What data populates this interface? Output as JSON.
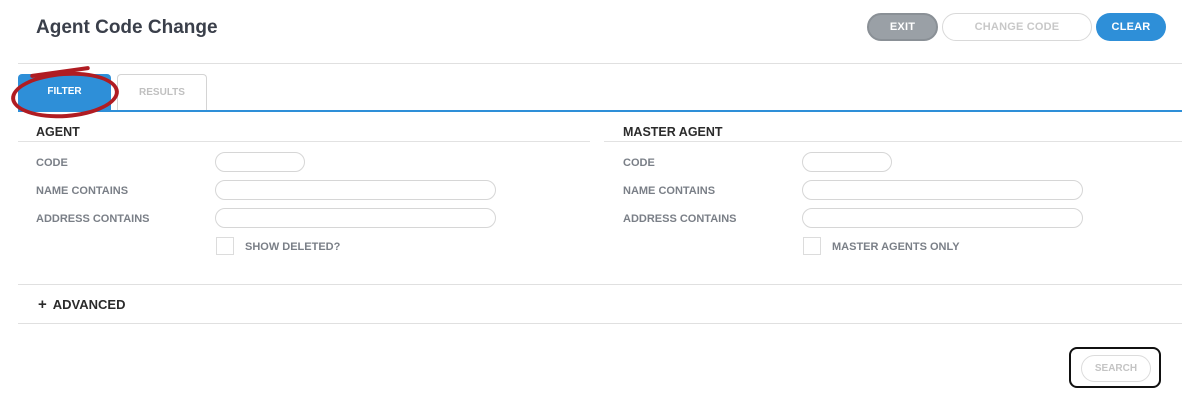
{
  "header": {
    "title": "Agent Code Change",
    "exit_label": "EXIT",
    "change_code_label": "CHANGE CODE",
    "clear_label": "CLEAR"
  },
  "tabs": [
    {
      "label": "FILTER",
      "active": true
    },
    {
      "label": "RESULTS",
      "active": false
    }
  ],
  "agent": {
    "title": "AGENT",
    "code_label": "CODE",
    "code_value": "",
    "name_label": "NAME CONTAINS",
    "name_value": "",
    "address_label": "ADDRESS CONTAINS",
    "address_value": "",
    "show_deleted_label": "SHOW DELETED?",
    "show_deleted_checked": false
  },
  "master_agent": {
    "title": "MASTER AGENT",
    "code_label": "CODE",
    "code_value": "",
    "name_label": "NAME CONTAINS",
    "name_value": "",
    "address_label": "ADDRESS CONTAINS",
    "address_value": "",
    "master_only_label": "MASTER AGENTS ONLY",
    "master_only_checked": false
  },
  "advanced": {
    "label": "ADVANCED",
    "icon": "plus-icon"
  },
  "search_label": "SEARCH",
  "colors": {
    "accent": "#2e8fd8",
    "exit_bg": "#9aa0a6",
    "annotation": "#b01c22"
  }
}
